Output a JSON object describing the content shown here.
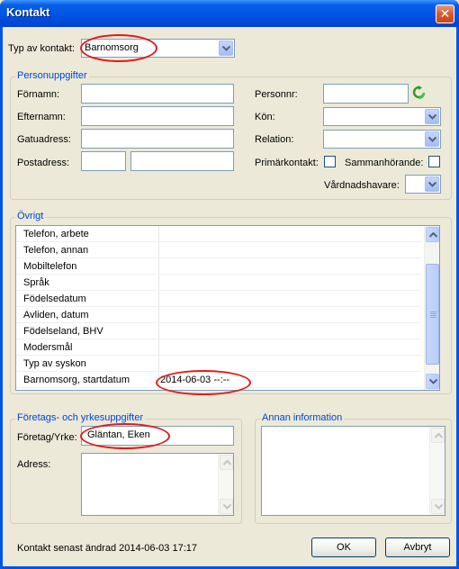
{
  "window": {
    "title": "Kontakt",
    "close_glyph": "✕"
  },
  "contact_type": {
    "label": "Typ av kontakt:",
    "value": "Barnomsorg"
  },
  "personuppgifter": {
    "title": "Personuppgifter",
    "fornamn": "Förnamn:",
    "efternamn": "Efternamn:",
    "gatuadress": "Gatuadress:",
    "postadress": "Postadress:",
    "personnr": "Personnr:",
    "kon": "Kön:",
    "relation": "Relation:",
    "primarkontakt": "Primärkontakt:",
    "sammanhorande": "Sammanhörande:",
    "vardnadshavare": "Vårdnadshavare:"
  },
  "ovrigt": {
    "title": "Övrigt",
    "rows": [
      {
        "label": "Telefon, arbete",
        "value": ""
      },
      {
        "label": "Telefon, annan",
        "value": ""
      },
      {
        "label": "Mobiltelefon",
        "value": ""
      },
      {
        "label": "Språk",
        "value": ""
      },
      {
        "label": "Födelsedatum",
        "value": ""
      },
      {
        "label": "Avliden, datum",
        "value": ""
      },
      {
        "label": "Födelseland, BHV",
        "value": ""
      },
      {
        "label": "Modersmål",
        "value": ""
      },
      {
        "label": "Typ av syskon",
        "value": ""
      },
      {
        "label": "Barnomsorg, startdatum",
        "value": "2014-06-03 --:--"
      }
    ]
  },
  "foretag": {
    "title": "Företags- och yrkesuppgifter",
    "yrke_label": "Företag/Yrke:",
    "yrke_value": "Gläntan, Eken",
    "adress_label": "Adress:"
  },
  "annan": {
    "title": "Annan information"
  },
  "footer": {
    "status": "Kontakt senast ändrad 2014-06-03 17:17",
    "ok": "OK",
    "cancel": "Avbryt"
  },
  "colors": {
    "annotation": "#e11a1a",
    "group_title": "#0046d5",
    "titlebar": "#0055e5"
  },
  "icons": {
    "refresh": "green-refresh-icon",
    "dropdown": "chevron-down-icon",
    "close": "close-icon"
  }
}
